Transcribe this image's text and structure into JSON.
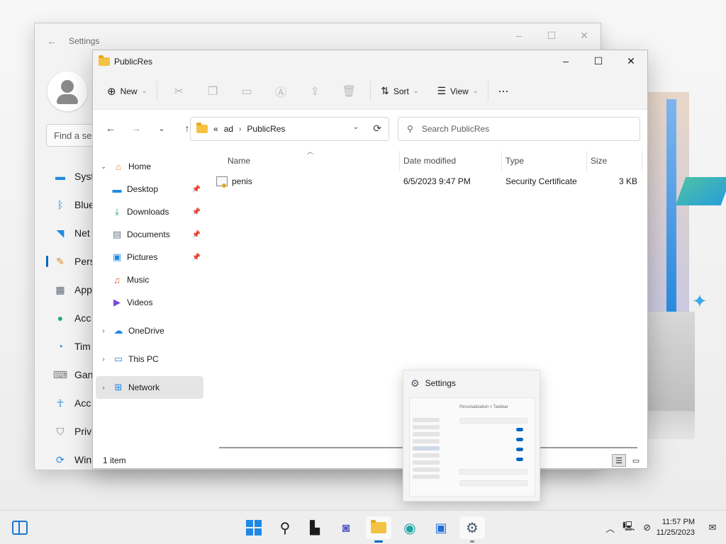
{
  "settings_window": {
    "title": "Settings",
    "search_placeholder": "Find a se",
    "nav": [
      {
        "label": "Syst",
        "icon": "system-icon",
        "color": "#1e88e5"
      },
      {
        "label": "Blue",
        "icon": "bluetooth-icon",
        "color": "#1e88e5"
      },
      {
        "label": "Net",
        "icon": "wifi-icon",
        "color": "#1e88e5"
      },
      {
        "label": "Pers",
        "icon": "brush-icon",
        "color": "#e08b2a"
      },
      {
        "label": "App",
        "icon": "apps-icon",
        "color": "#5a6a7a"
      },
      {
        "label": "Acc",
        "icon": "account-icon",
        "color": "#2aa87a"
      },
      {
        "label": "Tim",
        "icon": "time-icon",
        "color": "#1e88e5"
      },
      {
        "label": "Gan",
        "icon": "gaming-icon",
        "color": "#7a7a7a"
      },
      {
        "label": "Acc",
        "icon": "accessibility-icon",
        "color": "#1e88e5"
      },
      {
        "label": "Priv",
        "icon": "shield-icon",
        "color": "#7a7a7a"
      },
      {
        "label": "Win",
        "icon": "update-icon",
        "color": "#1e88e5"
      }
    ]
  },
  "explorer": {
    "title": "PublicRes",
    "toolbar": {
      "new_label": "New",
      "sort_label": "Sort",
      "view_label": "View",
      "more_label": "···"
    },
    "address": {
      "overflow": "«",
      "crumbs": [
        "ad",
        "PublicRes"
      ]
    },
    "search_placeholder": "Search PublicRes",
    "sidebar": [
      {
        "label": "Home",
        "icon": "home-icon",
        "level": 0,
        "expanded": true
      },
      {
        "label": "Desktop",
        "icon": "desktop-icon",
        "level": 1,
        "pinned": true
      },
      {
        "label": "Downloads",
        "icon": "downloads-icon",
        "level": 1,
        "pinned": true
      },
      {
        "label": "Documents",
        "icon": "documents-icon",
        "level": 1,
        "pinned": true
      },
      {
        "label": "Pictures",
        "icon": "pictures-icon",
        "level": 1,
        "pinned": true
      },
      {
        "label": "Music",
        "icon": "music-icon",
        "level": 1
      },
      {
        "label": "Videos",
        "icon": "videos-icon",
        "level": 1
      },
      {
        "label": "OneDrive",
        "icon": "onedrive-icon",
        "level": 0
      },
      {
        "label": "This PC",
        "icon": "pc-icon",
        "level": 0
      },
      {
        "label": "Network",
        "icon": "network-icon",
        "level": 0,
        "selected": true
      }
    ],
    "columns": [
      "Name",
      "Date modified",
      "Type",
      "Size"
    ],
    "files": [
      {
        "name": "penis",
        "date": "6/5/2023 9:47 PM",
        "type": "Security Certificate",
        "size": "3 KB"
      }
    ],
    "status": "1 item"
  },
  "preview": {
    "title": "Settings",
    "thumb_title": "Personalization > Taskbar"
  },
  "taskbar": {
    "time": "11:57 PM",
    "date": "11/25/2023"
  },
  "colors": {
    "accent": "#0067c0",
    "folder": "#f5c342"
  }
}
